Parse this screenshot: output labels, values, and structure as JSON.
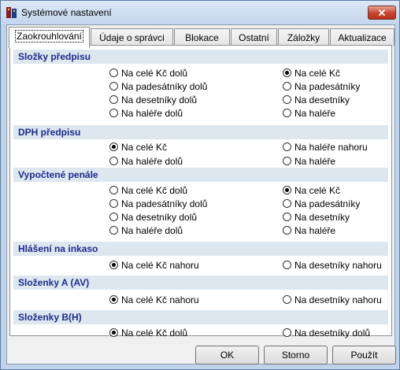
{
  "window": {
    "title": "Systémové nastavení",
    "close_label": "✕"
  },
  "tabs": [
    "Zaokrouhlování",
    "Údaje o správci",
    "Blokace",
    "Ostatní",
    "Záložky",
    "Aktualizace"
  ],
  "sections": {
    "slozky": {
      "title": "Složky předpisu",
      "left": [
        {
          "label": "Na celé Kč dolů",
          "selected": false
        },
        {
          "label": "Na padesátníky dolů",
          "selected": false
        },
        {
          "label": "Na desetníky dolů",
          "selected": false
        },
        {
          "label": "Na haléře dolů",
          "selected": false
        }
      ],
      "right": [
        {
          "label": "Na celé Kč",
          "selected": true
        },
        {
          "label": "Na padesátníky",
          "selected": false
        },
        {
          "label": "Na desetníky",
          "selected": false
        },
        {
          "label": "Na haléře",
          "selected": false
        }
      ]
    },
    "dph": {
      "title": "DPH předpisu",
      "left": [
        {
          "label": "Na celé Kč",
          "selected": true
        },
        {
          "label": "Na haléře dolů",
          "selected": false
        }
      ],
      "right": [
        {
          "label": "Na haléře nahoru",
          "selected": false
        },
        {
          "label": "Na haléře",
          "selected": false
        }
      ]
    },
    "penale": {
      "title": "Vypočtené penále",
      "left": [
        {
          "label": "Na celé Kč dolů",
          "selected": false
        },
        {
          "label": "Na padesátníky dolů",
          "selected": false
        },
        {
          "label": "Na desetníky dolů",
          "selected": false
        },
        {
          "label": "Na haléře dolů",
          "selected": false
        }
      ],
      "right": [
        {
          "label": "Na celé Kč",
          "selected": true
        },
        {
          "label": "Na padesátníky",
          "selected": false
        },
        {
          "label": "Na desetníky",
          "selected": false
        },
        {
          "label": "Na haléře",
          "selected": false
        }
      ]
    },
    "inkaso": {
      "title": "Hlášení na inkaso",
      "left": [
        {
          "label": "Na celé Kč nahoru",
          "selected": true
        }
      ],
      "right": [
        {
          "label": "Na desetníky nahoru",
          "selected": false
        }
      ]
    },
    "slozenky_a": {
      "title": "Složenky A (AV)",
      "left": [
        {
          "label": "Na celé Kč nahoru",
          "selected": true
        }
      ],
      "right": [
        {
          "label": "Na desetníky nahoru",
          "selected": false
        }
      ]
    },
    "slozenky_b": {
      "title": "Složenky B(H)",
      "left": [
        {
          "label": "Na celé Kč dolů",
          "selected": true
        }
      ],
      "right": [
        {
          "label": "Na desetníky dolů",
          "selected": false
        }
      ]
    }
  },
  "buttons": {
    "ok": "OK",
    "cancel": "Storno",
    "apply": "Použít"
  }
}
